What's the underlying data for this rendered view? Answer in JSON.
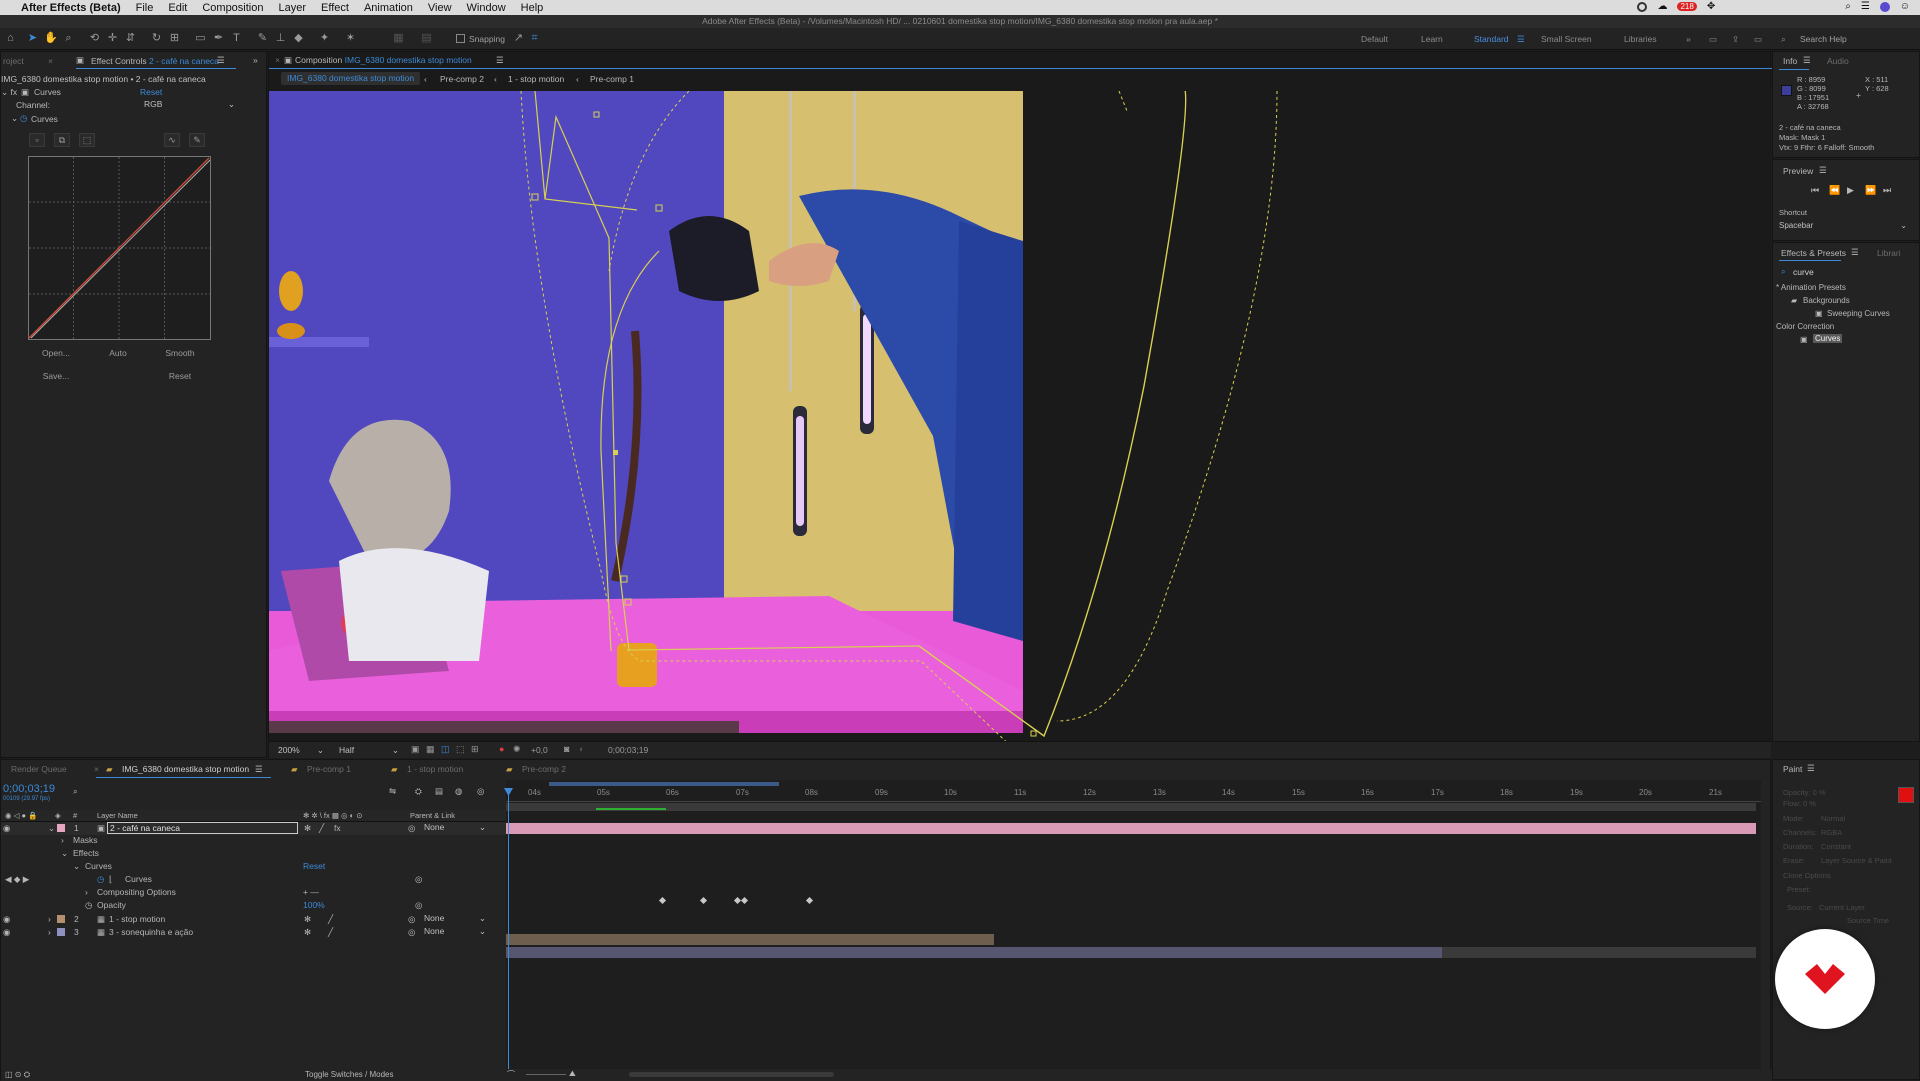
{
  "menubar": {
    "apple_icon": "apple-icon",
    "app_name": "After Effects (Beta)",
    "items": [
      "File",
      "Edit",
      "Composition",
      "Layer",
      "Effect",
      "Animation",
      "View",
      "Window",
      "Help"
    ],
    "badge": "218"
  },
  "window_title": "Adobe After Effects (Beta) - /Volumes/Macintosh HD/ ... 0210601 domestika stop motion/IMG_6380 domestika stop motion pra aula.aep *",
  "toolbar": {
    "snapping": "Snapping",
    "workspaces": [
      "Default",
      "Learn",
      "Standard",
      "Small Screen",
      "Libraries"
    ],
    "active_workspace": "Standard",
    "search_help": "Search Help"
  },
  "effect_controls": {
    "tab_project": "roject",
    "tab_label": "Effect Controls",
    "tab_layer": "2 - café na caneca",
    "breadcrumb": "IMG_6380 domestika stop motion • 2 - café na caneca",
    "effect_name": "Curves",
    "reset": "Reset",
    "channel_label": "Channel:",
    "channel_value": "RGB",
    "curves_group": "Curves",
    "buttons": {
      "open": "Open...",
      "auto": "Auto",
      "smooth": "Smooth",
      "save": "Save...",
      "reset": "Reset"
    }
  },
  "composition": {
    "tab_prefix": "Composition",
    "tab_name": "IMG_6380 domestika stop motion",
    "breadcrumbs": [
      "IMG_6380 domestika stop motion",
      "Pre-comp 2",
      "1 - stop motion",
      "Pre-comp 1"
    ],
    "zoom": "200%",
    "resolution": "Half",
    "exposure": "+0,0",
    "timecode": "0;00;03;19"
  },
  "info": {
    "tab_info": "Info",
    "tab_audio": "Audio",
    "r": "R :  8959",
    "g": "G :  8099",
    "b": "B :  17951",
    "a": "A :  32768",
    "x": "X : 511",
    "y": "Y : 628",
    "layer": "2 - café na caneca",
    "mask": "Mask: Mask 1",
    "vtx": "Vtx: 9 Fthr: 6 Falloff: Smooth",
    "swatch_color": "#3b3f9a"
  },
  "preview": {
    "title": "Preview",
    "shortcut_label": "Shortcut",
    "shortcut_value": "Spacebar"
  },
  "effects_presets": {
    "tab": "Effects & Presets",
    "tab2": "Librari",
    "search_value": "curve",
    "tree": [
      {
        "label": "* Animation Presets",
        "indent": 0
      },
      {
        "label": "Backgrounds",
        "indent": 1
      },
      {
        "label": "Sweeping Curves",
        "indent": 2
      },
      {
        "label": "Color Correction",
        "indent": 0
      },
      {
        "label": "Curves",
        "indent": 1,
        "selected": true
      }
    ]
  },
  "paint": {
    "title": "Paint",
    "opacity": "Opacity: 0 %",
    "flow": "Flow: 0 %",
    "mode_label": "Mode:",
    "mode_value": "Normal",
    "channels_label": "Channels:",
    "channels_value": "RGBA",
    "duration_label": "Duration:",
    "duration_value": "Constant",
    "erase_label": "Erase:",
    "erase_value": "Layer Source & Paint",
    "clone_options": "Clone Options",
    "preset_label": "Preset:",
    "source_label": "Source:",
    "source_value": "Current Layer",
    "source_time": "Source Time",
    "fg_color": "#e01010"
  },
  "timeline": {
    "tabs": [
      "Render Queue",
      "IMG_6380 domestika stop motion",
      "Pre-comp 1",
      "1 - stop motion",
      "Pre-comp 2"
    ],
    "timecode": "0;00;03;19",
    "fps": "00109 (29.97 fps)",
    "col_layer_name": "Layer Name",
    "col_parent": "Parent & Link",
    "ruler": [
      "04s",
      "05s",
      "06s",
      "07s",
      "08s",
      "09s",
      "10s",
      "11s",
      "12s",
      "13s",
      "14s",
      "15s",
      "16s",
      "17s",
      "18s",
      "19s",
      "20s",
      "21s"
    ],
    "layers": [
      {
        "num": "1",
        "name": "2 - café na caneca",
        "parent": "None"
      },
      {
        "num": "2",
        "name": "1 - stop motion",
        "parent": "None"
      },
      {
        "num": "3",
        "name": "3 - sonequinha e ação",
        "parent": "None"
      }
    ],
    "props": {
      "masks": "Masks",
      "effects": "Effects",
      "curves": "Curves",
      "reset": "Reset",
      "curves_prop": "Curves",
      "compositing": "Compositing Options",
      "opacity": "Opacity",
      "opacity_value": "100%"
    },
    "footer": "Toggle Switches / Modes"
  }
}
